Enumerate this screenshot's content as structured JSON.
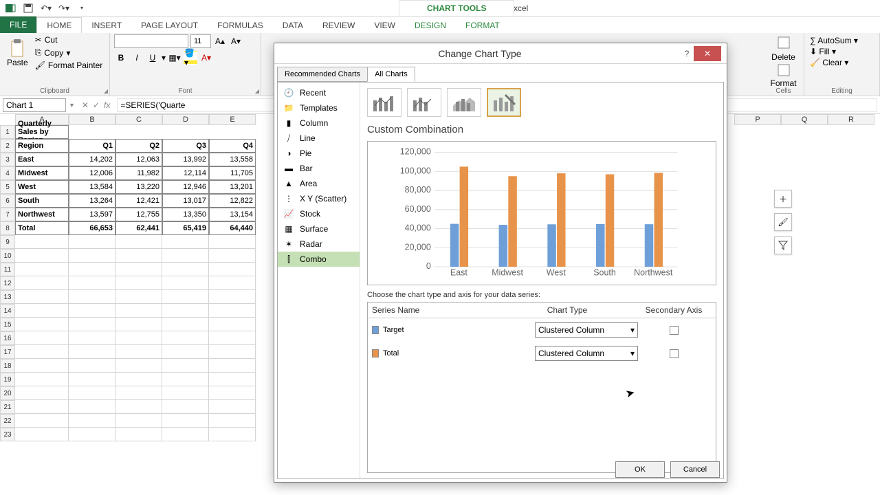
{
  "app": {
    "title": "Quarterly Sales - Excel",
    "chart_tools": "CHART TOOLS"
  },
  "tabs": {
    "file": "FILE",
    "home": "HOME",
    "insert": "INSERT",
    "page_layout": "PAGE LAYOUT",
    "formulas": "FORMULAS",
    "data": "DATA",
    "review": "REVIEW",
    "view": "VIEW",
    "design": "DESIGN",
    "format": "FORMAT"
  },
  "ribbon": {
    "paste": "Paste",
    "cut": "Cut",
    "copy": "Copy",
    "format_painter": "Format Painter",
    "clipboard": "Clipboard",
    "font": "Font",
    "font_size": "11",
    "cells": "Cells",
    "editing": "Editing",
    "delete": "Delete",
    "format": "Format",
    "autosum": "AutoSum",
    "fill": "Fill",
    "clear": "Clear"
  },
  "name_box": "Chart 1",
  "formula": "=SERIES('Quarte",
  "sheet": {
    "cols": [
      "A",
      "B",
      "C",
      "D",
      "E"
    ],
    "rows": [
      "1",
      "2",
      "3",
      "4",
      "5",
      "6",
      "7",
      "8",
      "9",
      "10",
      "11",
      "12",
      "13",
      "14",
      "15",
      "16",
      "17",
      "18",
      "19",
      "20",
      "21",
      "22",
      "23"
    ],
    "title": "Quarterly Sales by Region",
    "headers": [
      "Region",
      "Q1",
      "Q2",
      "Q3",
      "Q4"
    ],
    "data": [
      [
        "East",
        "14,202",
        "12,063",
        "13,992",
        "13,558"
      ],
      [
        "Midwest",
        "12,006",
        "11,982",
        "12,114",
        "11,705"
      ],
      [
        "West",
        "13,584",
        "13,220",
        "12,946",
        "13,201"
      ],
      [
        "South",
        "13,264",
        "12,421",
        "13,017",
        "12,822"
      ],
      [
        "Northwest",
        "13,597",
        "12,755",
        "13,350",
        "13,154"
      ],
      [
        "Total",
        "66,653",
        "62,441",
        "65,419",
        "64,440"
      ]
    ]
  },
  "extra_cols": [
    "P",
    "Q",
    "R"
  ],
  "dialog": {
    "title": "Change Chart Type",
    "tab_recommended": "Recommended Charts",
    "tab_all": "All Charts",
    "categories": [
      "Recent",
      "Templates",
      "Column",
      "Line",
      "Pie",
      "Bar",
      "Area",
      "X Y (Scatter)",
      "Stock",
      "Surface",
      "Radar",
      "Combo"
    ],
    "subtitle": "Custom Combination",
    "choose": "Choose the chart type and axis for your data series:",
    "col_series": "Series Name",
    "col_type": "Chart Type",
    "col_axis": "Secondary Axis",
    "series1": "Target",
    "series2": "Total",
    "type_value": "Clustered Column",
    "ok": "OK",
    "cancel": "Cancel"
  },
  "chart_data": {
    "type": "bar",
    "title": "",
    "categories": [
      "East",
      "Midwest",
      "West",
      "South",
      "Northwest"
    ],
    "series": [
      {
        "name": "Target",
        "color": "#6f9fd8",
        "values": [
          45000,
          44000,
          44500,
          44800,
          44600
        ]
      },
      {
        "name": "Total",
        "color": "#e8934a",
        "values": [
          105000,
          95000,
          98000,
          97000,
          98500
        ]
      }
    ],
    "ylabel": "",
    "yticks": [
      "0",
      "20,000",
      "40,000",
      "60,000",
      "80,000",
      "100,000",
      "120,000"
    ],
    "ylim": [
      0,
      120000
    ]
  }
}
